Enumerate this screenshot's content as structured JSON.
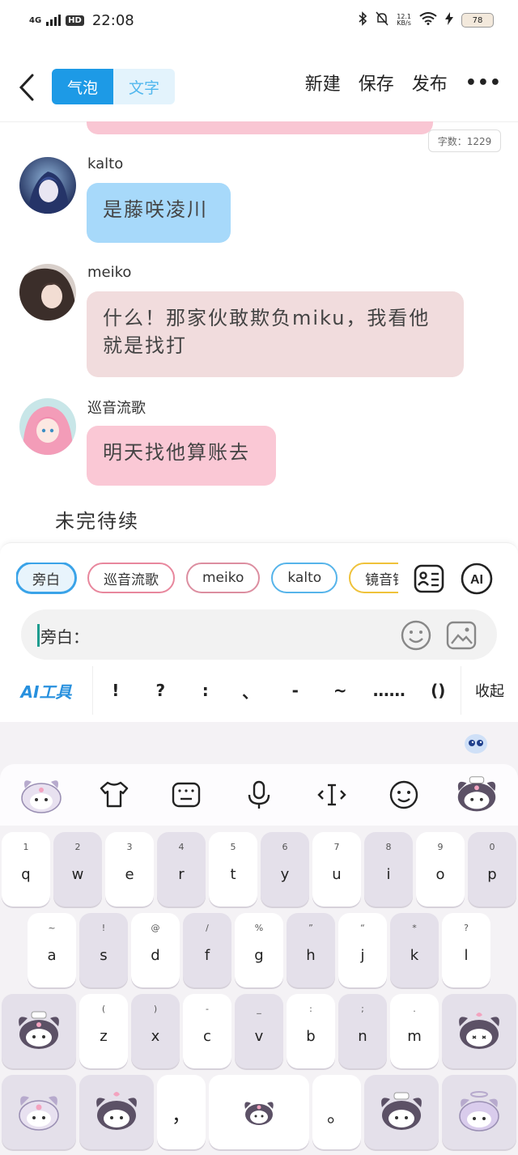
{
  "status_bar": {
    "signal": "4G",
    "hd": "HD",
    "time": "22:08",
    "net_speed_value": "12.1",
    "net_speed_unit": "KB/s",
    "battery": "78"
  },
  "nav": {
    "mode_bubble": "气泡",
    "mode_text": "文字",
    "new_label": "新建",
    "save_label": "保存",
    "publish_label": "发布",
    "more_label": "•••"
  },
  "word_count": "字数：1229",
  "messages": [
    {
      "sender": "kalto",
      "text": "是藤咲凌川"
    },
    {
      "sender": "meiko",
      "text_line1": "什么！那家伙敢欺负miku，我看他",
      "text_line2": "就是找打"
    },
    {
      "sender": "巡音流歌",
      "text": "明天找他算账去"
    }
  ],
  "narration": "未完待续",
  "chips": [
    "旁白",
    "巡音流歌",
    "meiko",
    "kalto",
    "镜音铃"
  ],
  "input": {
    "prefix": "旁白："
  },
  "punct_bar": {
    "ai_tools": "AI工具",
    "marks": [
      "!",
      "?",
      ":",
      "、",
      "-",
      "~",
      "……",
      "()"
    ],
    "collapse": "收起"
  },
  "keyboard": {
    "row1": [
      {
        "sub": "1",
        "key": "q"
      },
      {
        "sub": "2",
        "key": "w"
      },
      {
        "sub": "3",
        "key": "e"
      },
      {
        "sub": "4",
        "key": "r"
      },
      {
        "sub": "5",
        "key": "t"
      },
      {
        "sub": "6",
        "key": "y"
      },
      {
        "sub": "7",
        "key": "u"
      },
      {
        "sub": "8",
        "key": "i"
      },
      {
        "sub": "9",
        "key": "o"
      },
      {
        "sub": "0",
        "key": "p"
      }
    ],
    "row2": [
      {
        "sub": "~",
        "key": "a"
      },
      {
        "sub": "!",
        "key": "s"
      },
      {
        "sub": "@",
        "key": "d"
      },
      {
        "sub": "/",
        "key": "f"
      },
      {
        "sub": "%",
        "key": "g"
      },
      {
        "sub": "”",
        "key": "h"
      },
      {
        "sub": "“",
        "key": "j"
      },
      {
        "sub": "*",
        "key": "k"
      },
      {
        "sub": "?",
        "key": "l"
      }
    ],
    "row3": [
      {
        "sub": "(",
        "key": "z"
      },
      {
        "sub": ")",
        "key": "x"
      },
      {
        "sub": "-",
        "key": "c"
      },
      {
        "sub": "_",
        "key": "v"
      },
      {
        "sub": ":",
        "key": "b"
      },
      {
        "sub": ";",
        "key": "n"
      },
      {
        "sub": ".",
        "key": "m"
      }
    ],
    "comma": "，",
    "period": "。"
  },
  "colors": {
    "accent": "#1d9ae6",
    "bubble_blue": "#a7d9fa",
    "bubble_beige": "#f1dcdd",
    "bubble_pink": "#fac8d5",
    "ai_blue": "#2790de"
  }
}
